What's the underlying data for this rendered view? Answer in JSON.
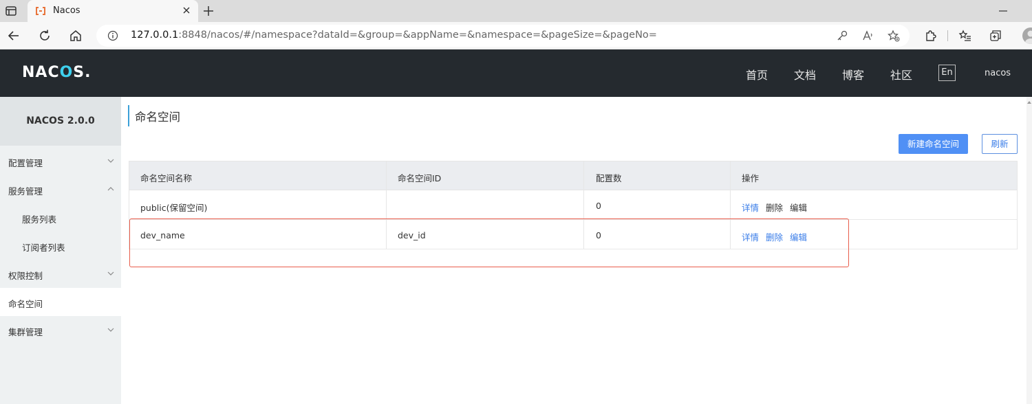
{
  "browser": {
    "tab_title": "Nacos",
    "url_host": "127.0.0.1",
    "url_rest": ":8848/nacos/#/namespace?dataId=&group=&appName=&namespace=&pageSize=&pageNo="
  },
  "header": {
    "logo_prefix": "NAC",
    "logo_o": "O",
    "logo_suffix": "S.",
    "nav": [
      "首页",
      "文档",
      "博客",
      "社区"
    ],
    "lang": "En",
    "user": "nacos"
  },
  "sidebar": {
    "title": "NACOS 2.0.0",
    "items": [
      {
        "label": "配置管理"
      },
      {
        "label": "服务管理"
      },
      {
        "label": "服务列表"
      },
      {
        "label": "订阅者列表"
      },
      {
        "label": "权限控制"
      },
      {
        "label": "命名空间"
      },
      {
        "label": "集群管理"
      }
    ]
  },
  "main": {
    "title": "命名空间",
    "create_button": "新建命名空间",
    "refresh_button": "刷新",
    "table": {
      "headers": [
        "命名空间名称",
        "命名空间ID",
        "配置数",
        "操作"
      ],
      "rows": [
        {
          "name": "public(保留空间)",
          "id": "",
          "count": "0",
          "actions": [
            "详情",
            "删除",
            "编辑"
          ]
        },
        {
          "name": "dev_name",
          "id": "dev_id",
          "count": "0",
          "actions": [
            "详情",
            "删除",
            "编辑"
          ]
        }
      ]
    }
  },
  "colors": {
    "header_bg": "#252a2f",
    "logo_accent": "#3ed0ee",
    "primary": "#5090f5",
    "link": "#3a7de8",
    "highlight": "#e85c4a"
  }
}
